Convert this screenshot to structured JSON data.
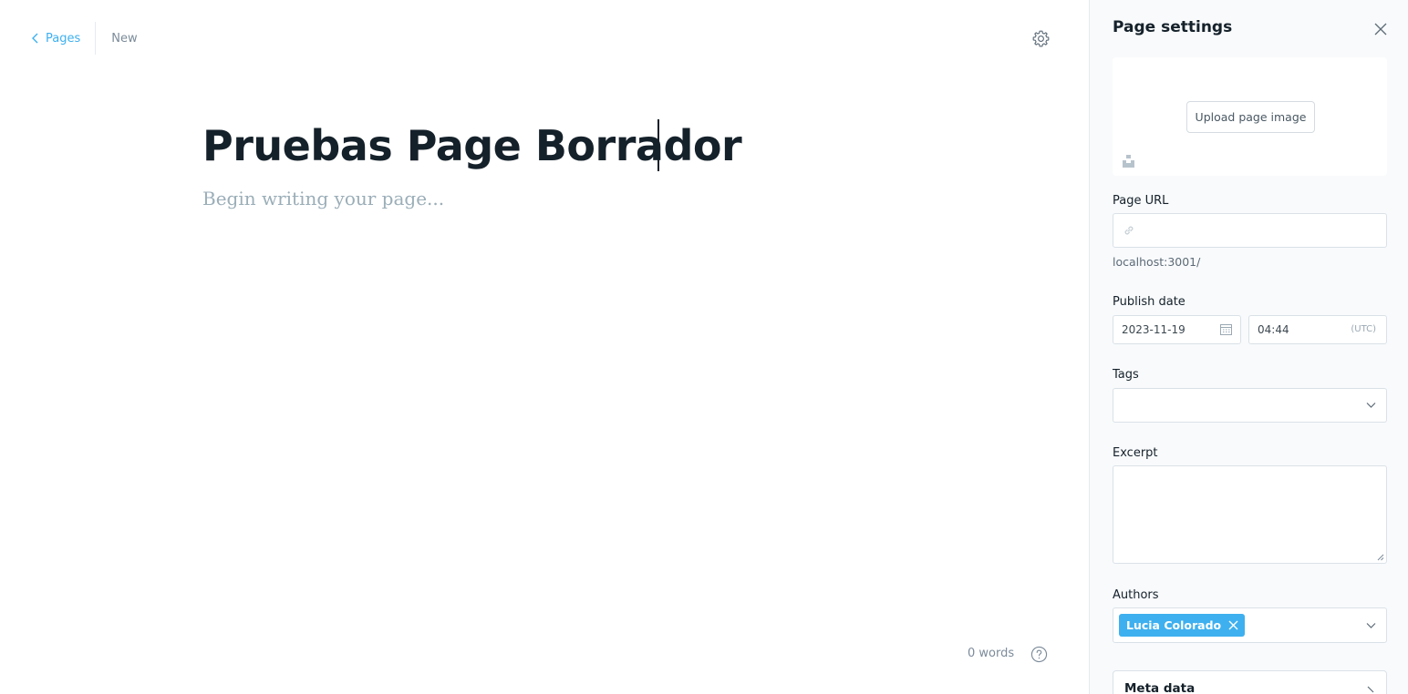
{
  "editor": {
    "breadcrumb": {
      "back_label": "Pages",
      "status": "New"
    },
    "title": "Pruebas Page Borrador",
    "body_placeholder": "Begin writing your page...",
    "word_count": "0 words"
  },
  "settings": {
    "title": "Page settings",
    "upload_image_label": "Upload page image",
    "page_url": {
      "label": "Page URL",
      "value": "",
      "hint": "localhost:3001/"
    },
    "publish_date": {
      "label": "Publish date",
      "date": "2023-11-19",
      "time": "04:44",
      "timezone": "(UTC)"
    },
    "tags": {
      "label": "Tags"
    },
    "excerpt": {
      "label": "Excerpt",
      "value": ""
    },
    "authors": {
      "label": "Authors",
      "selected": [
        "Lucia Colorado"
      ]
    },
    "meta_data": {
      "label": "Meta data"
    }
  },
  "colors": {
    "accent": "#3eb0ef",
    "text": "#15212a",
    "muted": "#7c8b9a",
    "panel_bg": "#f8fafc"
  },
  "icons": [
    "chevron-left-icon",
    "gear-icon",
    "question-icon",
    "close-icon",
    "unsplash-icon",
    "link-icon",
    "calendar-icon",
    "chevron-down-icon",
    "remove-icon",
    "arrow-icon"
  ]
}
